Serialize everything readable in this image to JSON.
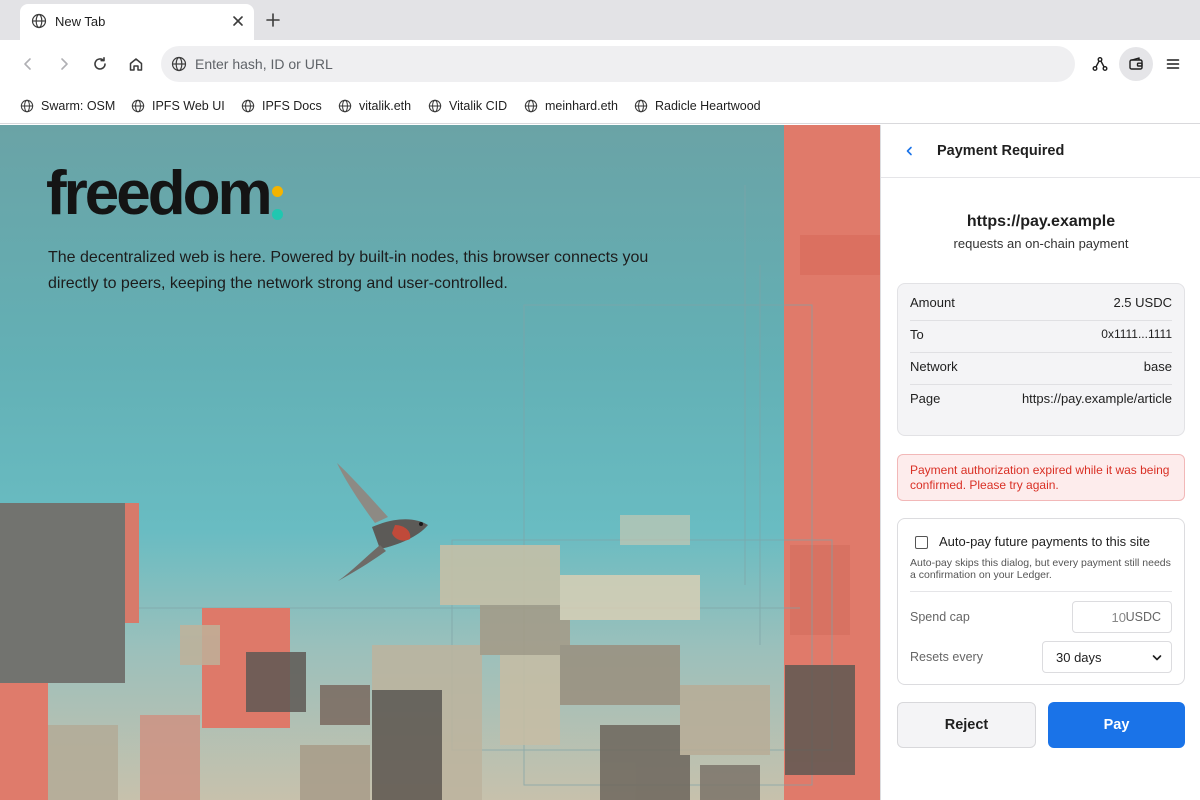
{
  "tab": {
    "title": "New Tab"
  },
  "omnibox": {
    "placeholder": "Enter hash, ID or URL"
  },
  "bookmarks": [
    {
      "label": "Swarm: OSM"
    },
    {
      "label": "IPFS Web UI"
    },
    {
      "label": "IPFS Docs"
    },
    {
      "label": "vitalik.eth"
    },
    {
      "label": "Vitalik CID"
    },
    {
      "label": "meinhard.eth"
    },
    {
      "label": "Radicle Heartwood"
    }
  ],
  "newtab_page": {
    "logo": "freedom",
    "tagline": "The decentralized web is here. Powered by built-in nodes, this browser connects you directly to peers, keeping the network strong and user-controlled."
  },
  "payment": {
    "title": "Payment Required",
    "origin": "https://pay.example",
    "origin_sub": "requests an on-chain payment",
    "details": [
      {
        "label": "Amount",
        "value": "2.5 USDC"
      },
      {
        "label": "To",
        "value": "0x1111...1111"
      },
      {
        "label": "Network",
        "value": "base"
      },
      {
        "label": "Page",
        "value": "https://pay.example/article"
      }
    ],
    "error": "Payment authorization expired while it was being confirmed. Please try again.",
    "autopay": {
      "label": "Auto-pay future payments to this site",
      "checked": false,
      "help": "Auto-pay skips this dialog, but every payment still needs a confirmation on your Ledger.",
      "spend_cap_label": "Spend cap",
      "spend_cap_placeholder": "10",
      "spend_cap_unit": "USDC",
      "resets_label": "Resets every",
      "resets_value": "30 days"
    },
    "reject_label": "Reject",
    "pay_label": "Pay"
  },
  "colors": {
    "accent": "#1a73e8",
    "error_text": "#d93025",
    "error_bg": "#fdecec",
    "logo_colon_top": "#f5b400",
    "logo_colon_bottom": "#20c7b0"
  }
}
